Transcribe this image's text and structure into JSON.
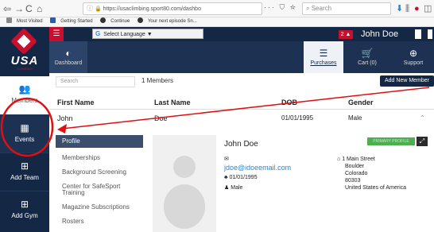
{
  "browser": {
    "back_icon": "back-arrow-icon",
    "forward_icon": "forward-arrow-icon",
    "reload_icon": "reload-icon",
    "home_icon": "home-icon",
    "url": "https://usaclimbing.sport80.com/dashbo",
    "url_extra": "··· ⛉ ☆",
    "search_placeholder": "Search",
    "bookmarks": [
      "Most Visited",
      "Getting Started",
      "Continue",
      "Your next episode Sn..."
    ]
  },
  "header": {
    "translate_label": "Select Language",
    "translate_arrow": "▼",
    "notification_count": "2",
    "username": "John Doe"
  },
  "sidebar": {
    "logo_text": "USA",
    "logo_sub": "CLIMBING",
    "items": [
      {
        "label": "Members",
        "icon": "users-icon"
      },
      {
        "label": "Events",
        "icon": "calendar-icon"
      },
      {
        "label": "Add Team",
        "icon": "plus-square-icon"
      },
      {
        "label": "Add Gym",
        "icon": "plus-square-icon"
      }
    ]
  },
  "navbar": {
    "tabs": [
      {
        "label": "Dashboard",
        "icon": "dashboard-icon"
      },
      {
        "label": "Purchases",
        "icon": "list-icon"
      },
      {
        "label": "Cart (0)",
        "icon": "cart-icon"
      },
      {
        "label": "Support",
        "icon": "support-icon"
      }
    ]
  },
  "members": {
    "search_placeholder": "Search",
    "count_label": "1 Members",
    "add_button": "Add New Member",
    "columns": [
      "First Name",
      "Last Name",
      "DOB",
      "Gender"
    ],
    "row": {
      "first": "John",
      "last": "Doe",
      "dob": "01/01/1995",
      "gender": "Male"
    }
  },
  "submenu": {
    "items": [
      "Profile",
      "Memberships",
      "Background Screening",
      "Center for SafeSport",
      "Training",
      "Magazine Subscriptions",
      "Rosters"
    ]
  },
  "profile": {
    "name": "John Doe",
    "badge": "PRIMARY PROFILE",
    "email": "jdoe@idoeemail.com",
    "dob": "01/01/1995",
    "gender": "Male",
    "address_line1": "1 Main Street",
    "city": "Boulder",
    "state": "Colorado",
    "zip": "80303",
    "country": "United States of America"
  },
  "annotation": {
    "color": "#e01010"
  }
}
